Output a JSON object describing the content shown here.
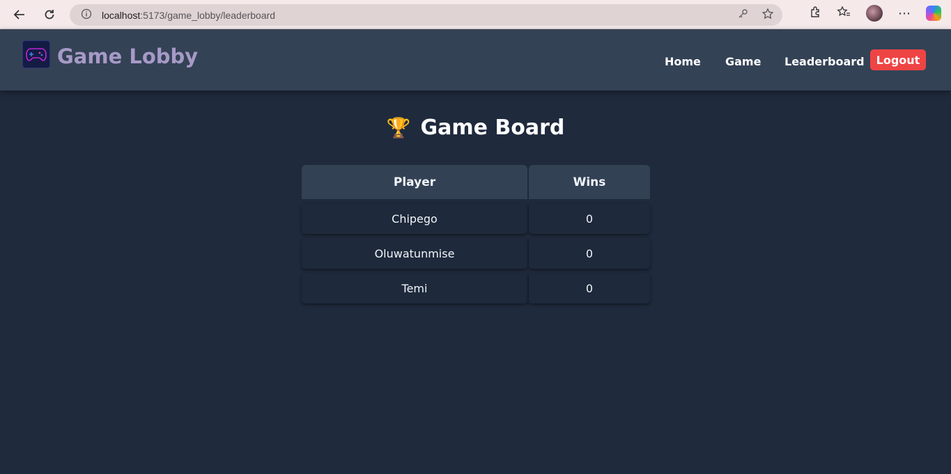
{
  "browser": {
    "url_host": "localhost",
    "url_path": ":5173/game_lobby/leaderboard"
  },
  "nav": {
    "brand": "Game Lobby",
    "links": [
      "Home",
      "Game",
      "Leaderboard"
    ],
    "logout": "Logout"
  },
  "page": {
    "title": "Game Board",
    "title_icon": "🏆"
  },
  "table": {
    "headers": {
      "player": "Player",
      "wins": "Wins"
    },
    "rows": [
      {
        "player": "Chipego",
        "wins": "0"
      },
      {
        "player": "Oluwatunmise",
        "wins": "0"
      },
      {
        "player": "Temi",
        "wins": "0"
      }
    ]
  },
  "colors": {
    "background": "#1f2a3c",
    "nav": "#344256",
    "brand": "#a79ac7",
    "logout": "#ef4444"
  }
}
